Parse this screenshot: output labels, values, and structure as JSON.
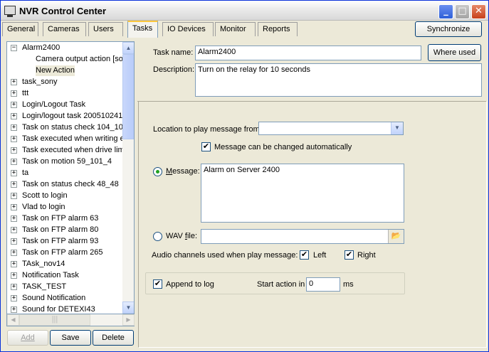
{
  "window": {
    "title": "NVR Control Center",
    "icon": "monitor-icon"
  },
  "tabs": [
    {
      "label": "General",
      "active": false
    },
    {
      "label": "Cameras",
      "active": false
    },
    {
      "label": "Users",
      "active": false
    },
    {
      "label": "Tasks",
      "active": true
    },
    {
      "label": "IO Devices",
      "active": false
    },
    {
      "label": "Monitor",
      "active": false
    },
    {
      "label": "Reports",
      "active": false
    }
  ],
  "synchronize_label": "Synchronize",
  "tree": {
    "items": [
      {
        "label": "Alarm2400",
        "expanded": true
      },
      {
        "label": "Camera output action [sor",
        "child": true
      },
      {
        "label": "New Action",
        "child": true,
        "selected": true
      },
      {
        "label": "task_sony"
      },
      {
        "label": "ttt"
      },
      {
        "label": "Login/Logout Task"
      },
      {
        "label": "Login/logout task 200510241"
      },
      {
        "label": "Task on status check 104_10"
      },
      {
        "label": "Task executed when writing e"
      },
      {
        "label": "Task executed when drive lim"
      },
      {
        "label": "Task on motion 59_101_4"
      },
      {
        "label": "ta"
      },
      {
        "label": "Task on status check 48_48"
      },
      {
        "label": "Scott to login"
      },
      {
        "label": "Vlad to login"
      },
      {
        "label": "Task on FTP alarm 63"
      },
      {
        "label": "Task on FTP alarm 80"
      },
      {
        "label": "Task on FTP alarm 93"
      },
      {
        "label": "Task on FTP alarm 265"
      },
      {
        "label": "TAsk_nov14"
      },
      {
        "label": "Notification Task"
      },
      {
        "label": "TASK_TEST"
      },
      {
        "label": "Sound Notification"
      },
      {
        "label": "Sound for DETEXI43"
      }
    ]
  },
  "buttons": {
    "add": "Add",
    "save": "Save",
    "delete": "Delete",
    "where_used": "Where used"
  },
  "task": {
    "name_label": "Task name:",
    "name_value": "Alarm2400",
    "description_label": "Description:",
    "description_value": "Turn on the relay for 10 seconds"
  },
  "action": {
    "location_label": "Location to play message from:",
    "location_value": "",
    "auto_change_label": "Message can be changed automatically",
    "auto_change_checked": true,
    "message_label": "Message:",
    "message_value": "Alarm on Server 2400",
    "message_selected": true,
    "wav_label": "WAV file:",
    "wav_value": "",
    "audio_channels_label": "Audio channels used when play message:",
    "left_label": "Left",
    "left_checked": true,
    "right_label": "Right",
    "right_checked": true,
    "append_label": "Append to log",
    "append_checked": true,
    "start_label": "Start action in",
    "start_value": "0",
    "start_unit": "ms"
  }
}
